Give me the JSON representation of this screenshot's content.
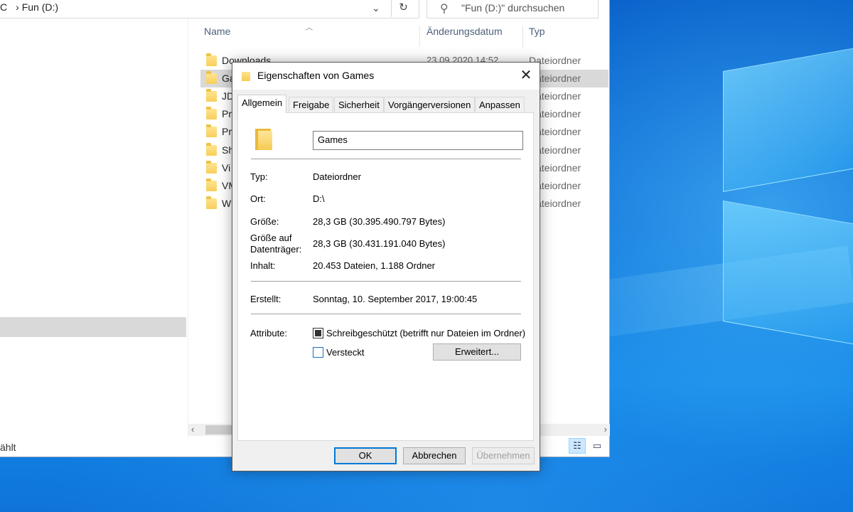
{
  "explorer": {
    "address_prefix": "C",
    "address_location": "Fun (D:)",
    "search_placeholder": "\"Fun (D:)\" durchsuchen",
    "columns": {
      "name": "Name",
      "date": "Änderungsdatum",
      "type": "Typ"
    },
    "files": [
      {
        "name": "Downloads",
        "date": "23.09.2020 14:52",
        "type": "Dateiordner"
      },
      {
        "name": "Ga",
        "date": "",
        "type": "Dateiordner"
      },
      {
        "name": "JD",
        "date": "",
        "type": "Dateiordner"
      },
      {
        "name": "Pr",
        "date": "",
        "type": "Dateiordner"
      },
      {
        "name": "Pr",
        "date": "",
        "type": "Dateiordner"
      },
      {
        "name": "Sh",
        "date": "",
        "type": "Dateiordner"
      },
      {
        "name": "Vi",
        "date": "",
        "type": "Dateiordner"
      },
      {
        "name": "VM",
        "date": "",
        "type": "Dateiordner"
      },
      {
        "name": "W",
        "date": "",
        "type": "Dateiordner"
      }
    ],
    "status_text": "ählt"
  },
  "dialog": {
    "title": "Eigenschaften von Games",
    "tabs": [
      "Allgemein",
      "Freigabe",
      "Sicherheit",
      "Vorgängerversionen",
      "Anpassen"
    ],
    "name_value": "Games",
    "props": {
      "type_label": "Typ:",
      "type_value": "Dateiordner",
      "location_label": "Ort:",
      "location_value": "D:\\",
      "size_label": "Größe:",
      "size_value": "28,3 GB (30.395.490.797 Bytes)",
      "disk_size_label_1": "Größe auf",
      "disk_size_label_2": "Datenträger:",
      "disk_size_value": "28,3 GB (30.431.191.040 Bytes)",
      "contents_label": "Inhalt:",
      "contents_value": "20.453 Dateien, 1.188 Ordner",
      "created_label": "Erstellt:",
      "created_value": "Sonntag, 10. September 2017, 19:00:45",
      "attributes_label": "Attribute:",
      "readonly_label": "Schreibgeschützt (betrifft nur Dateien im Ordner)",
      "hidden_label": "Versteckt",
      "advanced_button": "Erweitert..."
    },
    "buttons": {
      "ok": "OK",
      "cancel": "Abbrechen",
      "apply": "Übernehmen"
    }
  }
}
